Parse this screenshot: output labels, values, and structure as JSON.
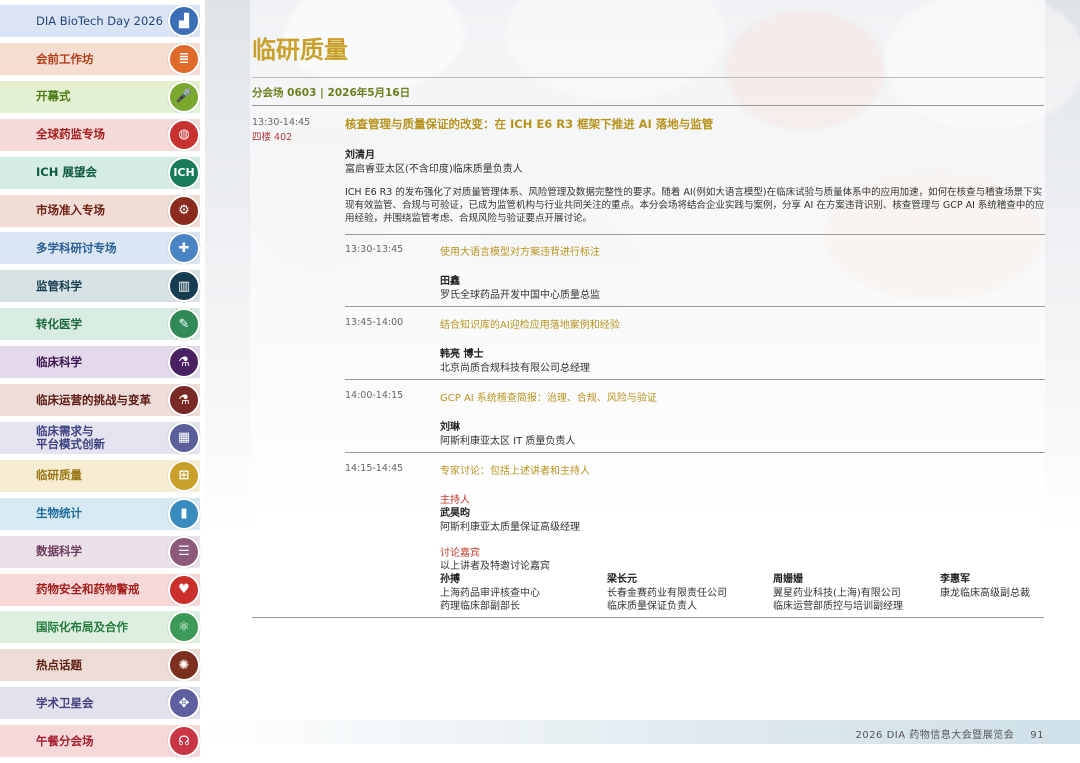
{
  "sidebar": [
    {
      "label": "DIA BioTech Day 2026",
      "icon": "bar-chart-icon",
      "bg": "#dbe4f4",
      "circle": "#3a6fb5",
      "labelColor": "#22447a"
    },
    {
      "label": "会前工作坊",
      "icon": "books-icon",
      "bg": "#f6ddd2",
      "circle": "#e06a2b",
      "labelColor": "#b1401b"
    },
    {
      "label": "开幕式",
      "icon": "microphone-icon",
      "bg": "#e3f0d2",
      "circle": "#7aa72e",
      "labelColor": "#4b7a16"
    },
    {
      "label": "全球药监专场",
      "icon": "globe-icon",
      "bg": "#f5dada",
      "circle": "#c8322f",
      "labelColor": "#a4201f"
    },
    {
      "label": "ICH 展望会",
      "icon": "ich-icon",
      "bg": "#d5ece3",
      "circle": "#177a5b",
      "labelColor": "#0f5a42"
    },
    {
      "label": "市场准入专场",
      "icon": "gear-icon",
      "bg": "#f1dcd6",
      "circle": "#8a2d1e",
      "labelColor": "#6e2014"
    },
    {
      "label": "多学科研讨专场",
      "icon": "medkit-icon",
      "bg": "#dae6f3",
      "circle": "#4a84c3",
      "labelColor": "#2b5f95"
    },
    {
      "label": "监管科学",
      "icon": "library-icon",
      "bg": "#d8e2e5",
      "circle": "#163d4f",
      "labelColor": "#163d4f"
    },
    {
      "label": "转化医学",
      "icon": "pencil-icon",
      "bg": "#d9ece1",
      "circle": "#2f8a58",
      "labelColor": "#1d6940"
    },
    {
      "label": "临床科学",
      "icon": "microscope-icon",
      "bg": "#e3d9ea",
      "circle": "#4a2263",
      "labelColor": "#3b154f"
    },
    {
      "label": "临床运营的挑战与变革",
      "icon": "flask-icon",
      "bg": "#eddcd7",
      "circle": "#7a2a24",
      "labelColor": "#5c1a16"
    },
    {
      "label": "临床需求与\n平台模式创新",
      "icon": "building-icon",
      "bg": "#e4e3f0",
      "circle": "#5b5f9c",
      "labelColor": "#3f4380"
    },
    {
      "label": "临研质量",
      "icon": "org-chart-icon",
      "bg": "#f6ecd2",
      "circle": "#c9a02a",
      "labelColor": "#9a7715"
    },
    {
      "label": "生物统计",
      "icon": "bar-graph-icon",
      "bg": "#d7e9f3",
      "circle": "#3a8cc0",
      "labelColor": "#1f6b9b"
    },
    {
      "label": "数据科学",
      "icon": "server-icon",
      "bg": "#ece0e8",
      "circle": "#8c5a7d",
      "labelColor": "#6d3e5f"
    },
    {
      "label": "药物安全和药物警戒",
      "icon": "heart-pulse-icon",
      "bg": "#f6d8d8",
      "circle": "#c9302c",
      "labelColor": "#a41f1c"
    },
    {
      "label": "国际化布局及合作",
      "icon": "atom-icon",
      "bg": "#dcefe0",
      "circle": "#3c9a57",
      "labelColor": "#237a3c"
    },
    {
      "label": "热点话题",
      "icon": "sun-icon",
      "bg": "#ecdcd5",
      "circle": "#7c2f1f",
      "labelColor": "#5e1e12"
    },
    {
      "label": "学术卫星会",
      "icon": "compass-icon",
      "bg": "#e2e2ef",
      "circle": "#5e5ea0",
      "labelColor": "#43437f"
    },
    {
      "label": "午餐分会场",
      "icon": "headset-icon",
      "bg": "#f5d9da",
      "circle": "#c93544",
      "labelColor": "#a41f2d"
    }
  ],
  "page_title": "临研质量",
  "session": "分会场 0603 | 2026年5月16日",
  "main_talk": {
    "time": "13:30-14:45",
    "room": "四楼 402",
    "title": "核查管理与质量保证的改变：在 ICH E6 R3 框架下推进 AI 落地与监管",
    "speaker": "刘清月",
    "affiliation": "富启睿亚太区(不含印度)临床质量负责人",
    "description": "ICH E6 R3 的发布强化了对质量管理体系、风险管理及数据完整性的要求。随着 AI(例如大语言模型)在临床试验与质量体系中的应用加速，如何在核查与稽查场景下实现有效监管、合规与可验证，已成为监管机构与行业共同关注的重点。本分会场将结合企业实践与案例，分享 AI 在方案违背识别、核查管理与 GCP AI 系统稽查中的应用经验，并围绕监管考虑、合规风险与验证要点开展讨论。"
  },
  "subtalks": [
    {
      "time": "13:30-13:45",
      "title": "使用大语言模型对方案违背进行标注",
      "speaker": "田鑫",
      "affiliation": "罗氏全球药品开发中国中心质量总监"
    },
    {
      "time": "13:45-14:00",
      "title": "结合知识库的AI迎检应用落地案例和经验",
      "speaker": "韩亮 博士",
      "affiliation": "北京尚质合规科技有限公司总经理"
    },
    {
      "time": "14:00-14:15",
      "title": "GCP AI 系统稽查简报：治理、合规、风险与验证",
      "speaker": "刘琳",
      "affiliation": "阿斯利康亚太区 IT 质量负责人"
    }
  ],
  "panel": {
    "time": "14:15-14:45",
    "title": "专家讨论：包括上述讲者和主持人",
    "host_label": "主持人",
    "host_name": "武昊昀",
    "host_aff": "阿斯利康亚太质量保证高级经理",
    "guests_label": "讨论嘉宾",
    "guests_intro": "以上讲者及特邀讨论嘉宾",
    "guests": [
      {
        "name": "孙搏",
        "aff1": "上海药品审评核查中心",
        "aff2": "药理临床部副部长"
      },
      {
        "name": "梁长元",
        "aff1": "长春金赛药业有限责任公司",
        "aff2": "临床质量保证负责人"
      },
      {
        "name": "周姗姗",
        "aff1": "翼星药业科技(上海)有限公司",
        "aff2": "临床运营部质控与培训副经理"
      },
      {
        "name": "李惠军",
        "aff1": "康龙临床高级副总裁",
        "aff2": ""
      }
    ]
  },
  "footer": {
    "text": "2026 DIA 药物信息大会暨展览会",
    "page": "91"
  }
}
